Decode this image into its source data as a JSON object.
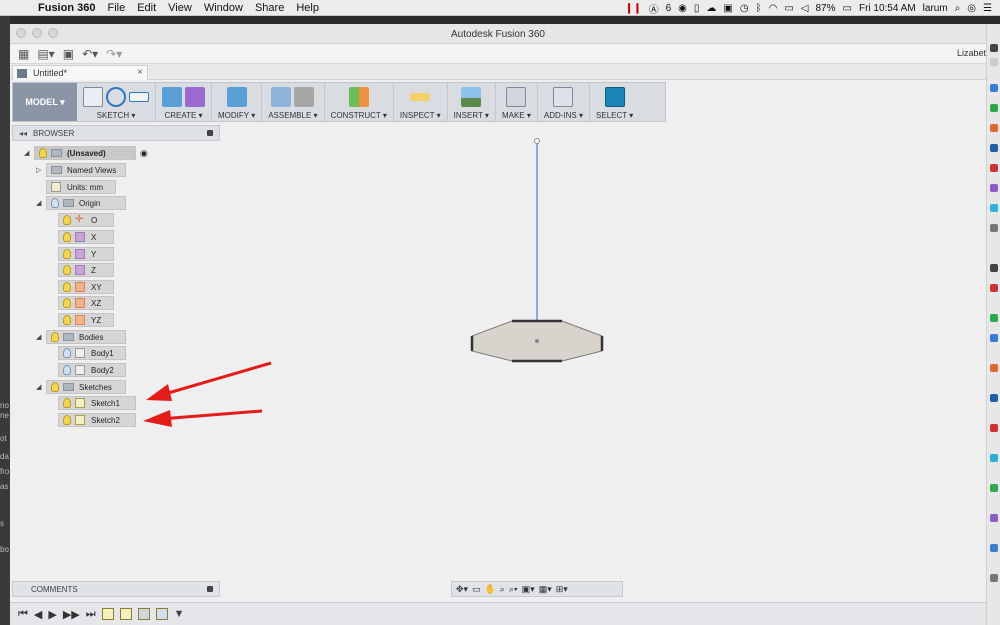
{
  "menubar": {
    "apple": "",
    "app_name": "Fusion 360",
    "items": [
      "File",
      "Edit",
      "View",
      "Window",
      "Share",
      "Help"
    ],
    "status": {
      "adobe_count": "6",
      "battery": "87%",
      "clock": "Fri 10:54 AM",
      "user": "larum"
    }
  },
  "window": {
    "title": "Autodesk Fusion 360",
    "user_label": "Lizabet"
  },
  "tab": {
    "label": "Untitled*",
    "close": "×"
  },
  "toolbar": {
    "workspace": "MODEL ▾",
    "groups": [
      {
        "label": "SKETCH ▾"
      },
      {
        "label": "CREATE ▾"
      },
      {
        "label": "MODIFY ▾"
      },
      {
        "label": "ASSEMBLE ▾"
      },
      {
        "label": "CONSTRUCT ▾"
      },
      {
        "label": "INSPECT ▾"
      },
      {
        "label": "INSERT ▾"
      },
      {
        "label": "MAKE ▾"
      },
      {
        "label": "ADD-INS ▾"
      },
      {
        "label": "SELECT ▾"
      }
    ]
  },
  "browser": {
    "title": "BROWSER",
    "toggle": "◂◂",
    "root": "(Unsaved)",
    "named_views": "Named Views",
    "units": "Units: mm",
    "origin": "Origin",
    "origin_items": [
      "O",
      "X",
      "Y",
      "Z",
      "XY",
      "XZ",
      "YZ"
    ],
    "bodies": "Bodies",
    "body_items": [
      "Body1",
      "Body2"
    ],
    "sketches": "Sketches",
    "sketch_items": [
      "Sketch1",
      "Sketch2"
    ]
  },
  "comments": {
    "title": "COMMENTS"
  },
  "desk_left_text": [
    "no",
    "ne",
    "ot",
    "da",
    "fro",
    "as",
    "s",
    "bo"
  ],
  "colors": {
    "arrow": "#e41b17",
    "select_active": "#1b84b8",
    "axis_line": "#3b5bdb",
    "body_fill": "#d9d3cd"
  },
  "timeline": {
    "controls": [
      "⏮",
      "◀",
      "▶",
      "▶▶",
      "⏭"
    ]
  }
}
